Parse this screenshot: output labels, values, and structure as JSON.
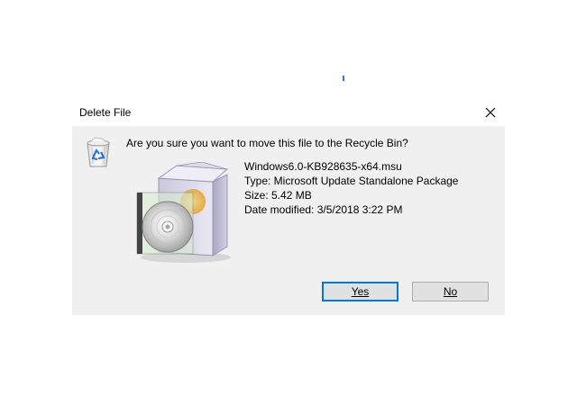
{
  "dialog": {
    "title": "Delete File",
    "question": "Are you sure you want to move this file to the Recycle Bin?",
    "file": {
      "name": "Windows6.0-KB928635-x64.msu",
      "type": "Type: Microsoft Update Standalone Package",
      "size": "Size: 5.42 MB",
      "modified": "Date modified: 3/5/2018 3:22 PM"
    },
    "buttons": {
      "yes": "Yes",
      "no": "No"
    },
    "icons": {
      "recycle": "recycle-bin-icon",
      "package": "software-package-icon",
      "close": "close-icon"
    }
  }
}
